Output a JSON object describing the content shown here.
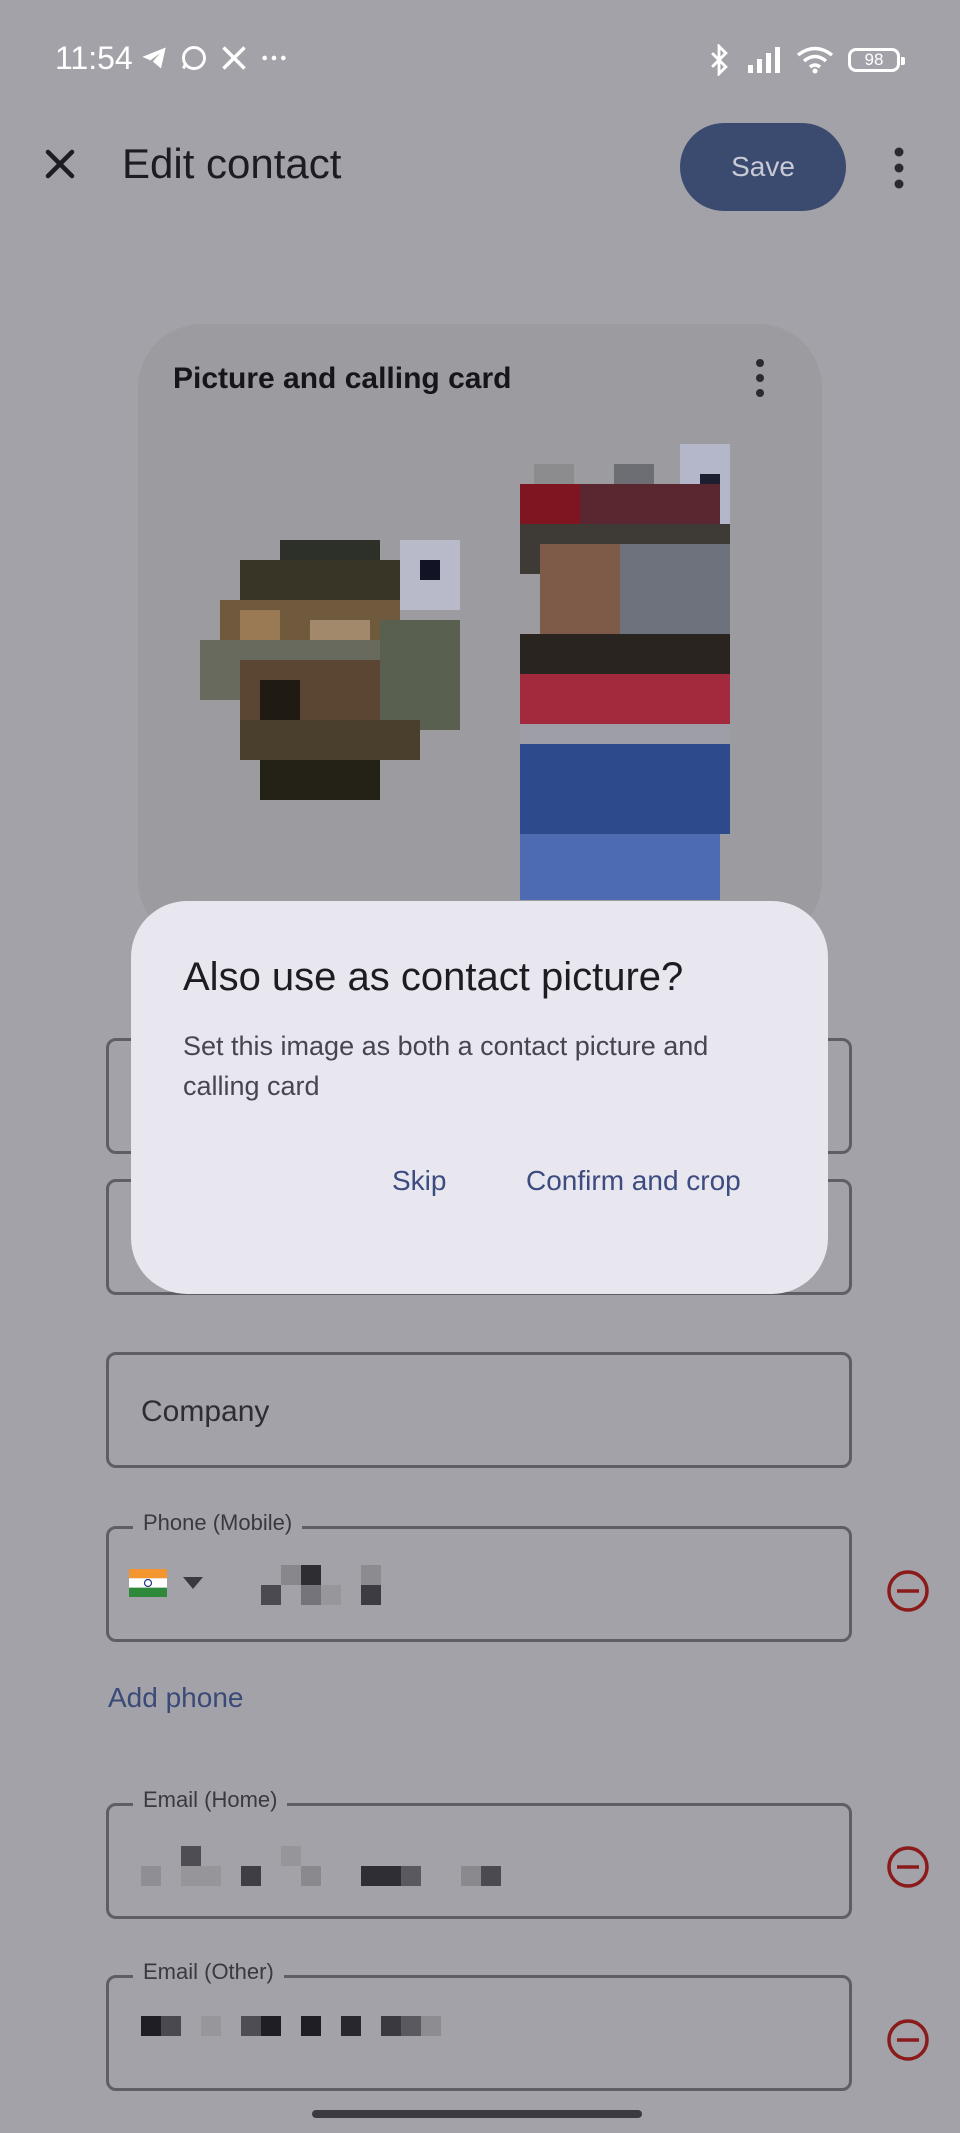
{
  "status_bar": {
    "time": "11:54",
    "battery": "98",
    "left_icons": [
      "telegram-icon",
      "whatsapp-icon",
      "x-icon",
      "more-dots-icon"
    ],
    "right_icons": [
      "bluetooth-icon",
      "signal-icon",
      "wifi-icon",
      "battery-icon"
    ]
  },
  "app_bar": {
    "title": "Edit contact",
    "save_label": "Save"
  },
  "card": {
    "title": "Picture and calling card"
  },
  "dialog": {
    "title": "Also use as contact picture?",
    "body": "Set this image as both a contact picture and calling card",
    "skip_label": "Skip",
    "confirm_label": "Confirm and crop"
  },
  "fields": {
    "company_placeholder": "Company",
    "phone_label": "Phone (Mobile)",
    "email_home_label": "Email (Home)",
    "email_other_label": "Email (Other)",
    "add_phone_label": "Add phone"
  },
  "colors": {
    "scrim_background": "#a3a2a8",
    "primary": "#3b4a6f",
    "dialog_surface": "#e8e7ef",
    "remove_red": "#8b1a1a"
  }
}
